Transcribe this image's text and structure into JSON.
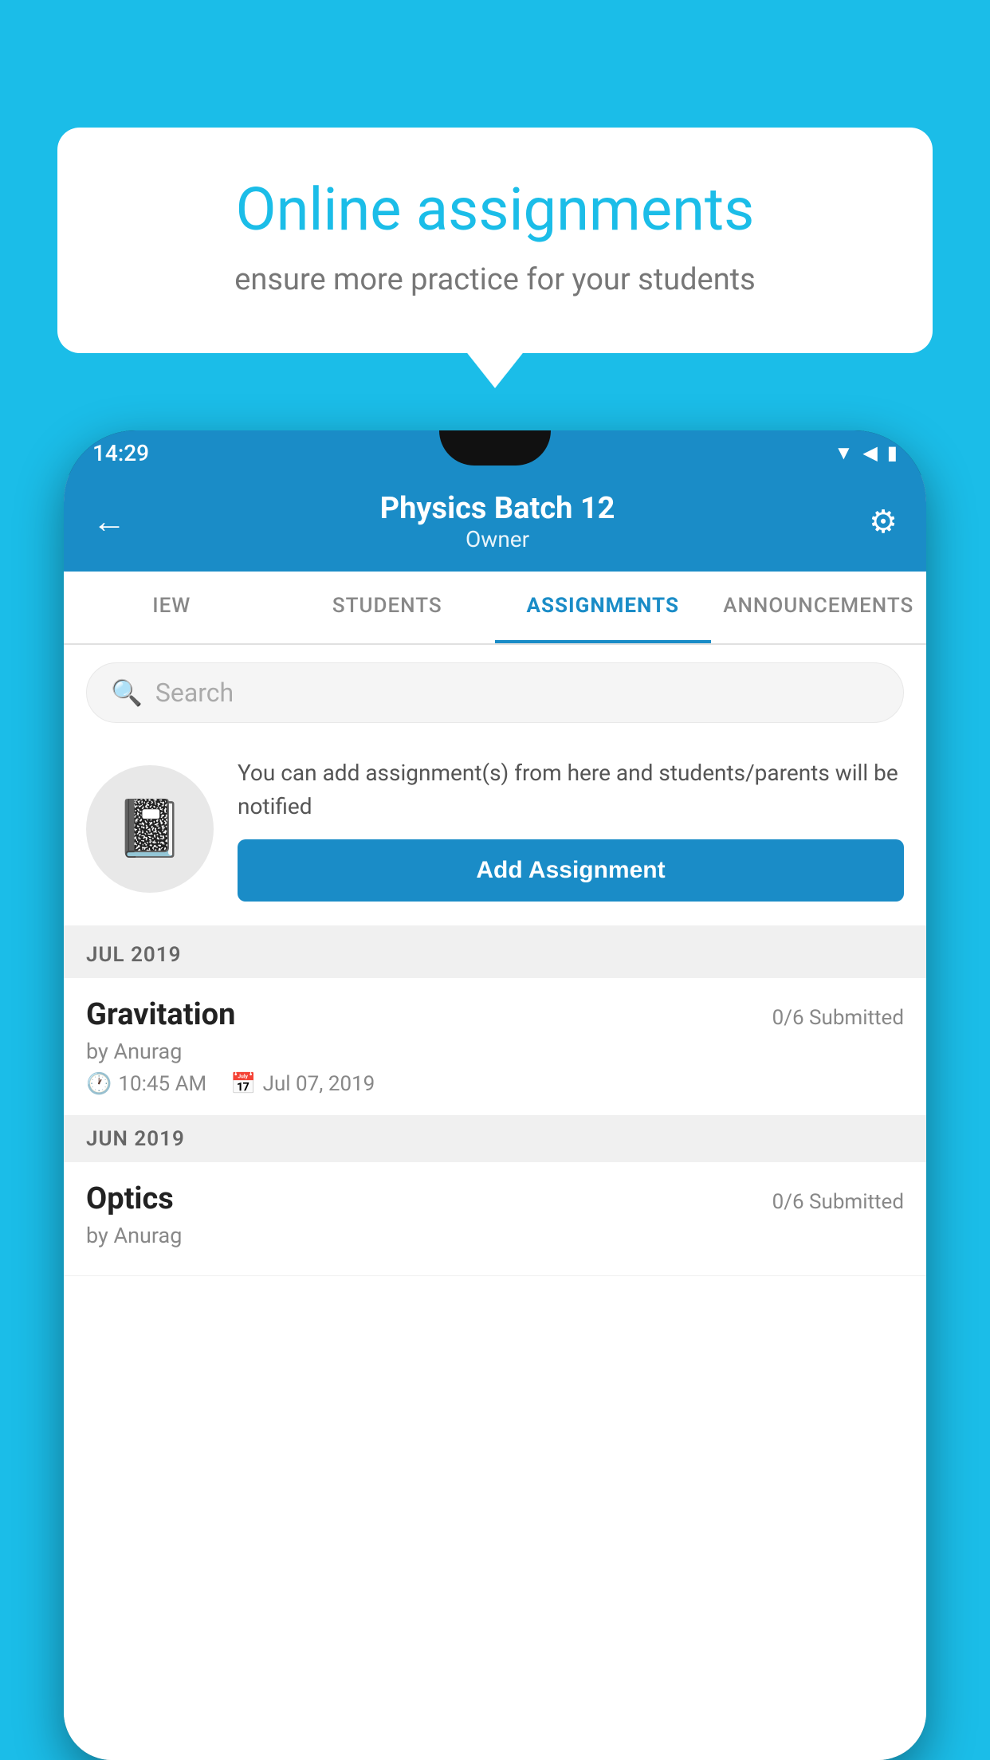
{
  "background_color": "#1BBDE8",
  "speech_bubble": {
    "title": "Online assignments",
    "subtitle": "ensure more practice for your students"
  },
  "status_bar": {
    "time": "14:29",
    "icons": [
      "▼",
      "◀",
      "▮"
    ]
  },
  "header": {
    "title": "Physics Batch 12",
    "subtitle": "Owner",
    "back_label": "←",
    "settings_label": "⚙"
  },
  "tabs": [
    {
      "label": "IEW",
      "active": false
    },
    {
      "label": "STUDENTS",
      "active": false
    },
    {
      "label": "ASSIGNMENTS",
      "active": true
    },
    {
      "label": "ANNOUNCEMENTS",
      "active": false
    }
  ],
  "search": {
    "placeholder": "Search"
  },
  "promo": {
    "text": "You can add assignment(s) from here and students/parents will be notified",
    "button_label": "Add Assignment"
  },
  "sections": [
    {
      "month": "JUL 2019",
      "assignments": [
        {
          "name": "Gravitation",
          "submitted": "0/6 Submitted",
          "author": "by Anurag",
          "time": "10:45 AM",
          "date": "Jul 07, 2019"
        }
      ]
    },
    {
      "month": "JUN 2019",
      "assignments": [
        {
          "name": "Optics",
          "submitted": "0/6 Submitted",
          "author": "by Anurag",
          "time": "",
          "date": ""
        }
      ]
    }
  ]
}
